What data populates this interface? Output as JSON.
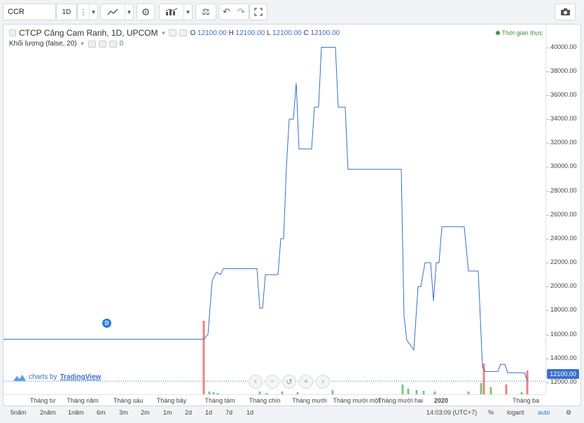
{
  "toolbar": {
    "symbol": "CCR",
    "interval": "1D",
    "icons": [
      "more-icon",
      "line-chart-icon",
      "settings-icon",
      "indicators-icon",
      "compare-icon",
      "undo-icon",
      "redo-icon",
      "fullscreen-icon",
      "camera-icon"
    ]
  },
  "legend": {
    "title": "CTCP Cảng Cam Ranh, 1D, UPCOM",
    "o_label": "O",
    "o": "12100.00",
    "h_label": "H",
    "h": "12100.00",
    "l_label": "L",
    "l": "12100.00",
    "c_label": "C",
    "c": "12100.00",
    "volume_label": "Khối lượng (false, 20)",
    "volume_value": "0",
    "realtime": "Thời gian thực"
  },
  "price_axis": {
    "ticks": [
      "40000.00",
      "38000.00",
      "36000.00",
      "34000.00",
      "32000.00",
      "30000.00",
      "28000.00",
      "26000.00",
      "24000.00",
      "22000.00",
      "20000.00",
      "18000.00",
      "16000.00",
      "14000.00",
      "12000.00"
    ],
    "current": "12100.00"
  },
  "time_axis": {
    "ticks": [
      "Tháng tư",
      "Tháng năm",
      "Tháng sáu",
      "Tháng bảy",
      "Tháng tám",
      "Tháng chín",
      "Tháng mười",
      "Tháng mười một",
      "Tháng mười hai",
      "2020",
      "Tháng ba"
    ]
  },
  "marker": "D",
  "branding": {
    "prefix": "charts by",
    "name": "TradingView"
  },
  "bottom": {
    "ranges": [
      "5năm",
      "2năm",
      "1năm",
      "6m",
      "3m",
      "2m",
      "1m",
      "2d",
      "1d",
      "7d",
      "1d"
    ],
    "clock": "14:03:09 (UTC+7)",
    "percent": "%",
    "log": "logarit",
    "auto": "auto"
  },
  "colors": {
    "line": "#3a6fc6",
    "up_volume": "#7cc77e",
    "down_volume": "#f08080",
    "accent": "#2a7be0"
  },
  "chart_data": {
    "type": "line",
    "ylim": [
      11000,
      40500
    ],
    "series_price": [
      [
        0,
        15600
      ],
      [
        286,
        15600
      ],
      [
        292,
        16000
      ],
      [
        298,
        20500
      ],
      [
        304,
        21200
      ],
      [
        310,
        21000
      ],
      [
        314,
        21500
      ],
      [
        362,
        21500
      ],
      [
        366,
        18200
      ],
      [
        370,
        18200
      ],
      [
        374,
        21000
      ],
      [
        392,
        21000
      ],
      [
        396,
        24000
      ],
      [
        400,
        24000
      ],
      [
        404,
        30000
      ],
      [
        408,
        34000
      ],
      [
        414,
        34000
      ],
      [
        418,
        37000
      ],
      [
        422,
        31500
      ],
      [
        440,
        31500
      ],
      [
        444,
        35000
      ],
      [
        450,
        35000
      ],
      [
        454,
        40000
      ],
      [
        474,
        40000
      ],
      [
        478,
        35000
      ],
      [
        488,
        35000
      ],
      [
        492,
        29800
      ],
      [
        568,
        29800
      ],
      [
        572,
        17500
      ],
      [
        576,
        15500
      ],
      [
        580,
        15200
      ],
      [
        586,
        14700
      ],
      [
        592,
        20000
      ],
      [
        596,
        20000
      ],
      [
        602,
        22000
      ],
      [
        610,
        22000
      ],
      [
        614,
        18800
      ],
      [
        618,
        22000
      ],
      [
        622,
        22000
      ],
      [
        626,
        25000
      ],
      [
        658,
        25000
      ],
      [
        664,
        21300
      ],
      [
        678,
        21300
      ],
      [
        684,
        13300
      ],
      [
        688,
        12900
      ],
      [
        706,
        12900
      ],
      [
        710,
        13500
      ],
      [
        716,
        13500
      ],
      [
        720,
        12800
      ],
      [
        744,
        12800
      ],
      [
        748,
        12100
      ]
    ],
    "volume_bars": [
      {
        "x": 286,
        "h": 105,
        "c": "down"
      },
      {
        "x": 294,
        "h": 4,
        "c": "up"
      },
      {
        "x": 300,
        "h": 3,
        "c": "up"
      },
      {
        "x": 306,
        "h": 2,
        "c": "up"
      },
      {
        "x": 366,
        "h": 4,
        "c": "up"
      },
      {
        "x": 376,
        "h": 2,
        "c": "up"
      },
      {
        "x": 398,
        "h": 4,
        "c": "up"
      },
      {
        "x": 420,
        "h": 3,
        "c": "up"
      },
      {
        "x": 470,
        "h": 6,
        "c": "up"
      },
      {
        "x": 570,
        "h": 14,
        "c": "up"
      },
      {
        "x": 578,
        "h": 8,
        "c": "up"
      },
      {
        "x": 590,
        "h": 6,
        "c": "up"
      },
      {
        "x": 600,
        "h": 5,
        "c": "up"
      },
      {
        "x": 616,
        "h": 4,
        "c": "up"
      },
      {
        "x": 664,
        "h": 4,
        "c": "up"
      },
      {
        "x": 682,
        "h": 16,
        "c": "up"
      },
      {
        "x": 686,
        "h": 44,
        "c": "down"
      },
      {
        "x": 696,
        "h": 10,
        "c": "up"
      },
      {
        "x": 718,
        "h": 14,
        "c": "down"
      },
      {
        "x": 740,
        "h": 3,
        "c": "up"
      },
      {
        "x": 748,
        "h": 34,
        "c": "down"
      }
    ]
  }
}
